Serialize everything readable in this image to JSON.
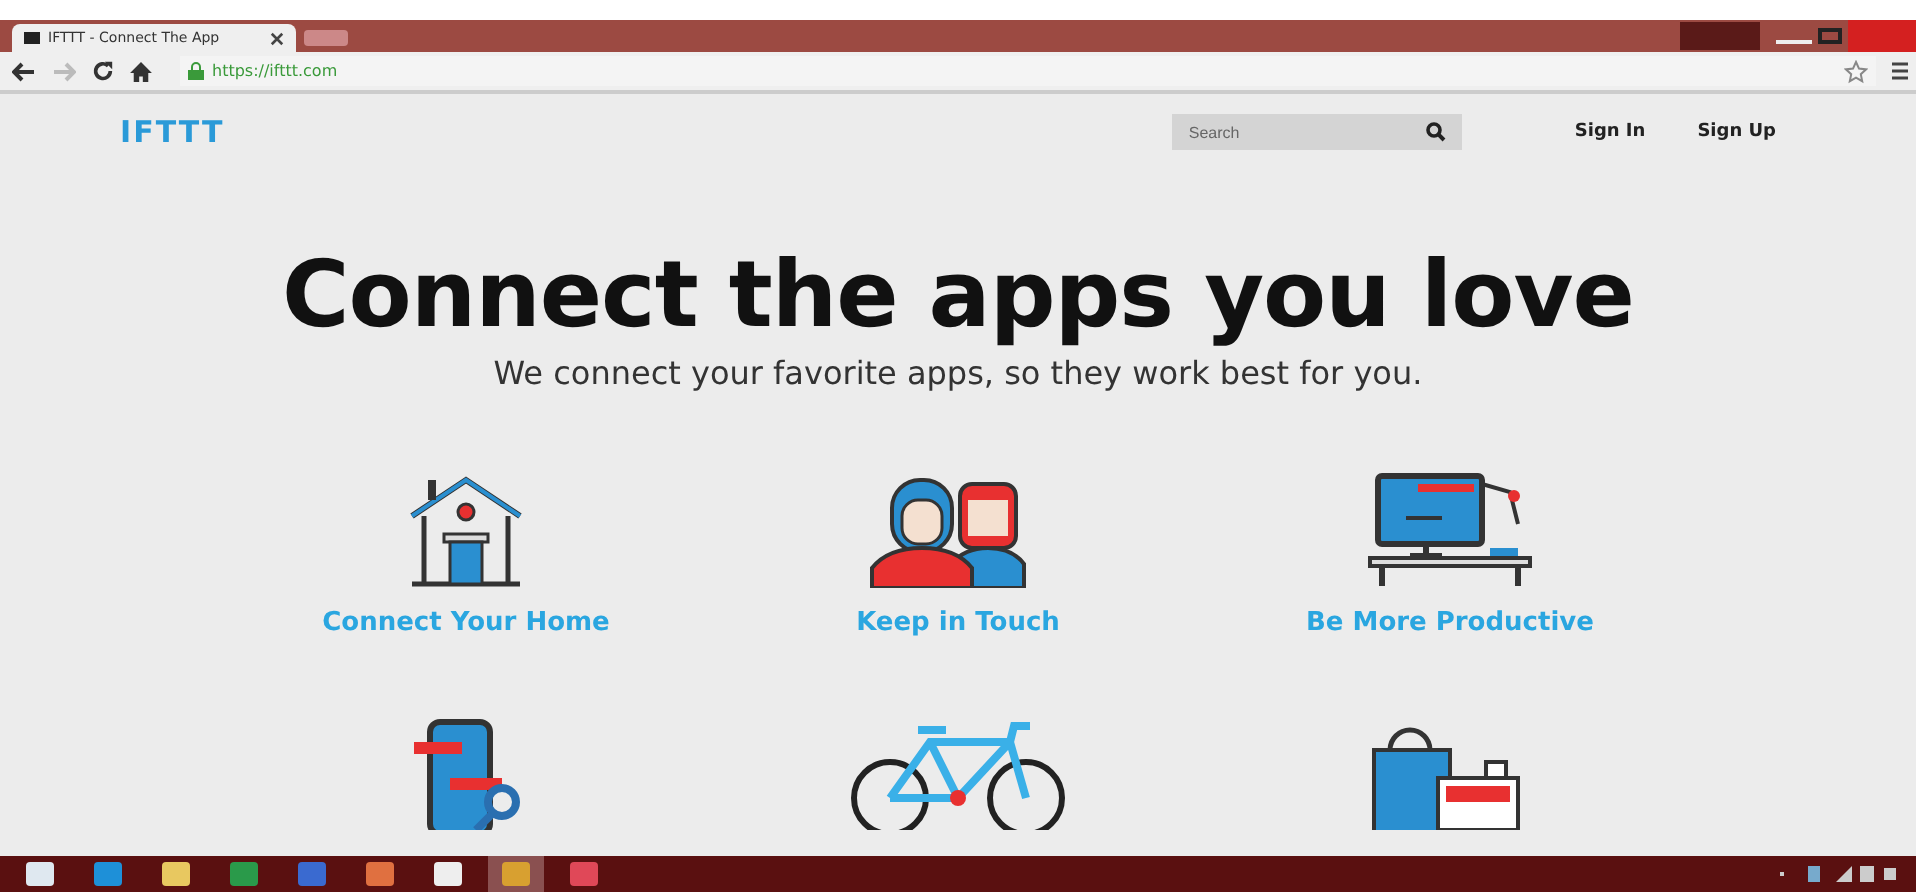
{
  "browser": {
    "tab_title": "IFTTT - Connect The App",
    "url": "https://ifttt.com"
  },
  "header": {
    "logo": "IFTTT",
    "search": {
      "placeholder": "Search"
    },
    "links": [
      "Sign In",
      "Sign Up"
    ]
  },
  "hero": {
    "title": "Connect the apps you love",
    "subtitle": "We connect your favorite apps, so they work best for you."
  },
  "features": [
    {
      "kind": "home",
      "label": "Connect Your Home"
    },
    {
      "kind": "people",
      "label": "Keep in Touch"
    },
    {
      "kind": "desk",
      "label": "Be More Productive"
    },
    {
      "kind": "phone"
    },
    {
      "kind": "bike"
    },
    {
      "kind": "shop"
    }
  ],
  "taskbar": [
    {
      "kind": "start",
      "selected": false
    },
    {
      "kind": "ie",
      "selected": false
    },
    {
      "kind": "folder",
      "selected": false
    },
    {
      "kind": "green",
      "selected": false
    },
    {
      "kind": "blue",
      "selected": false
    },
    {
      "kind": "orange",
      "selected": false
    },
    {
      "kind": "dark",
      "selected": false
    },
    {
      "kind": "chrome",
      "selected": true
    },
    {
      "kind": "red",
      "selected": false
    }
  ]
}
